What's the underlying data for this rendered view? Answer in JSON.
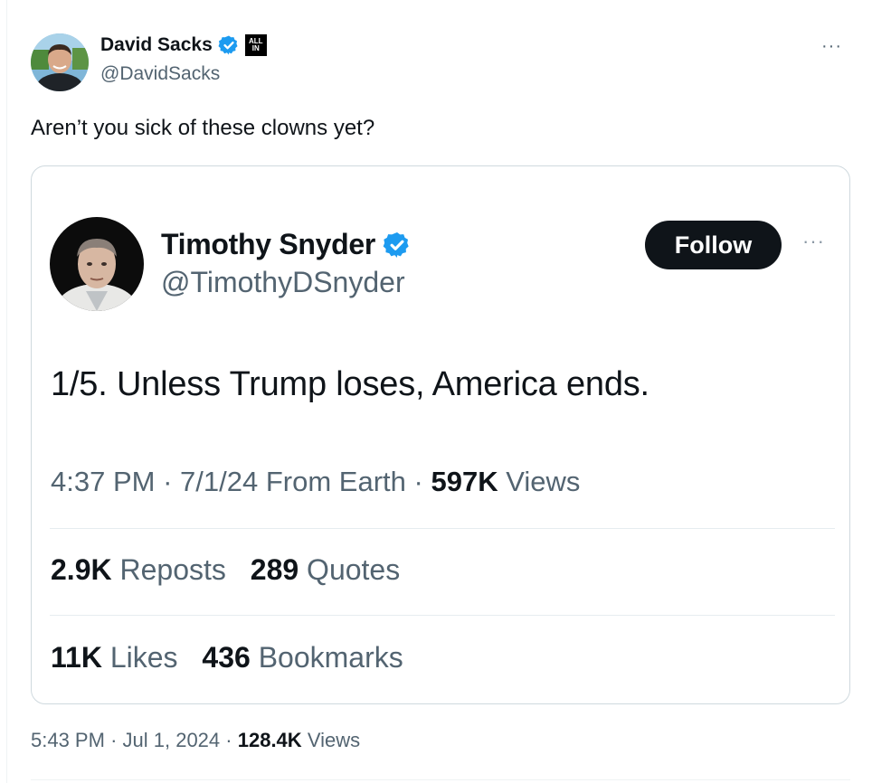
{
  "tweet": {
    "author_name": "David Sacks",
    "author_handle": "@DavidSacks",
    "affiliate_badge_line1": "ALL",
    "affiliate_badge_line2": "IN",
    "more_label": "···",
    "text": "Aren’t you sick of these clowns yet?",
    "time": "5:43 PM",
    "date": "Jul 1, 2024",
    "views_count": "128.4K",
    "views_label": "Views",
    "separator": "·"
  },
  "quoted": {
    "author_name": "Timothy Snyder",
    "author_handle": "@TimothyDSnyder",
    "follow_label": "Follow",
    "more_label": "···",
    "text": "1/5.  Unless Trump loses, America ends.",
    "time": "4:37 PM",
    "date": "7/1/24",
    "source": "From Earth",
    "views_count": "597K",
    "views_label": "Views",
    "separator": "·",
    "reposts_count": "2.9K",
    "reposts_label": "Reposts",
    "quotes_count": "289",
    "quotes_label": "Quotes",
    "likes_count": "11K",
    "likes_label": "Likes",
    "bookmarks_count": "436",
    "bookmarks_label": "Bookmarks"
  },
  "colors": {
    "verified_blue": "#1d9bf0",
    "text_primary": "#0f1419",
    "text_secondary": "#536471",
    "border": "#cfd9de"
  }
}
